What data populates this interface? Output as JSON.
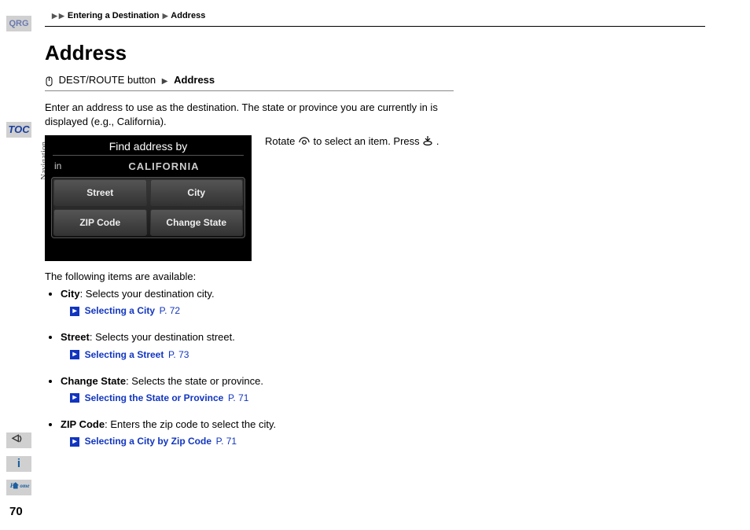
{
  "sidebar": {
    "qrg": "QRG",
    "toc": "TOC",
    "section_vert": "Navigation",
    "voice": "✎",
    "info": "i",
    "home": "Home",
    "page_number": "70"
  },
  "breadcrumb": {
    "level1": "",
    "level2": "Entering a Destination",
    "level3": "Address"
  },
  "title": "Address",
  "menu_path": {
    "button": "DEST/ROUTE button",
    "target": "Address"
  },
  "intro": "Enter an address to use as the destination. The state or province you are currently in is displayed (e.g., California).",
  "screenshot": {
    "header": "Find address by",
    "in_label": "in",
    "state": "CALIFORNIA",
    "cells": [
      "Street",
      "City",
      "ZIP Code",
      "Change State"
    ]
  },
  "rotate_caption": {
    "pre": "Rotate ",
    "mid": " to select an item. Press ",
    "post": "."
  },
  "available_label": "The following items are available:",
  "items": [
    {
      "label": "City",
      "desc": ": Selects your destination city.",
      "link": "Selecting a City",
      "page": "P. 72"
    },
    {
      "label": "Street",
      "desc": ": Selects your destination street.",
      "link": "Selecting a Street",
      "page": "P. 73"
    },
    {
      "label": "Change State",
      "desc": ": Selects the state or province.",
      "link": "Selecting the State or Province",
      "page": "P. 71"
    },
    {
      "label": "ZIP Code",
      "desc": ": Enters the zip code to select the city.",
      "link": "Selecting a City by Zip Code",
      "page": "P. 71"
    }
  ]
}
